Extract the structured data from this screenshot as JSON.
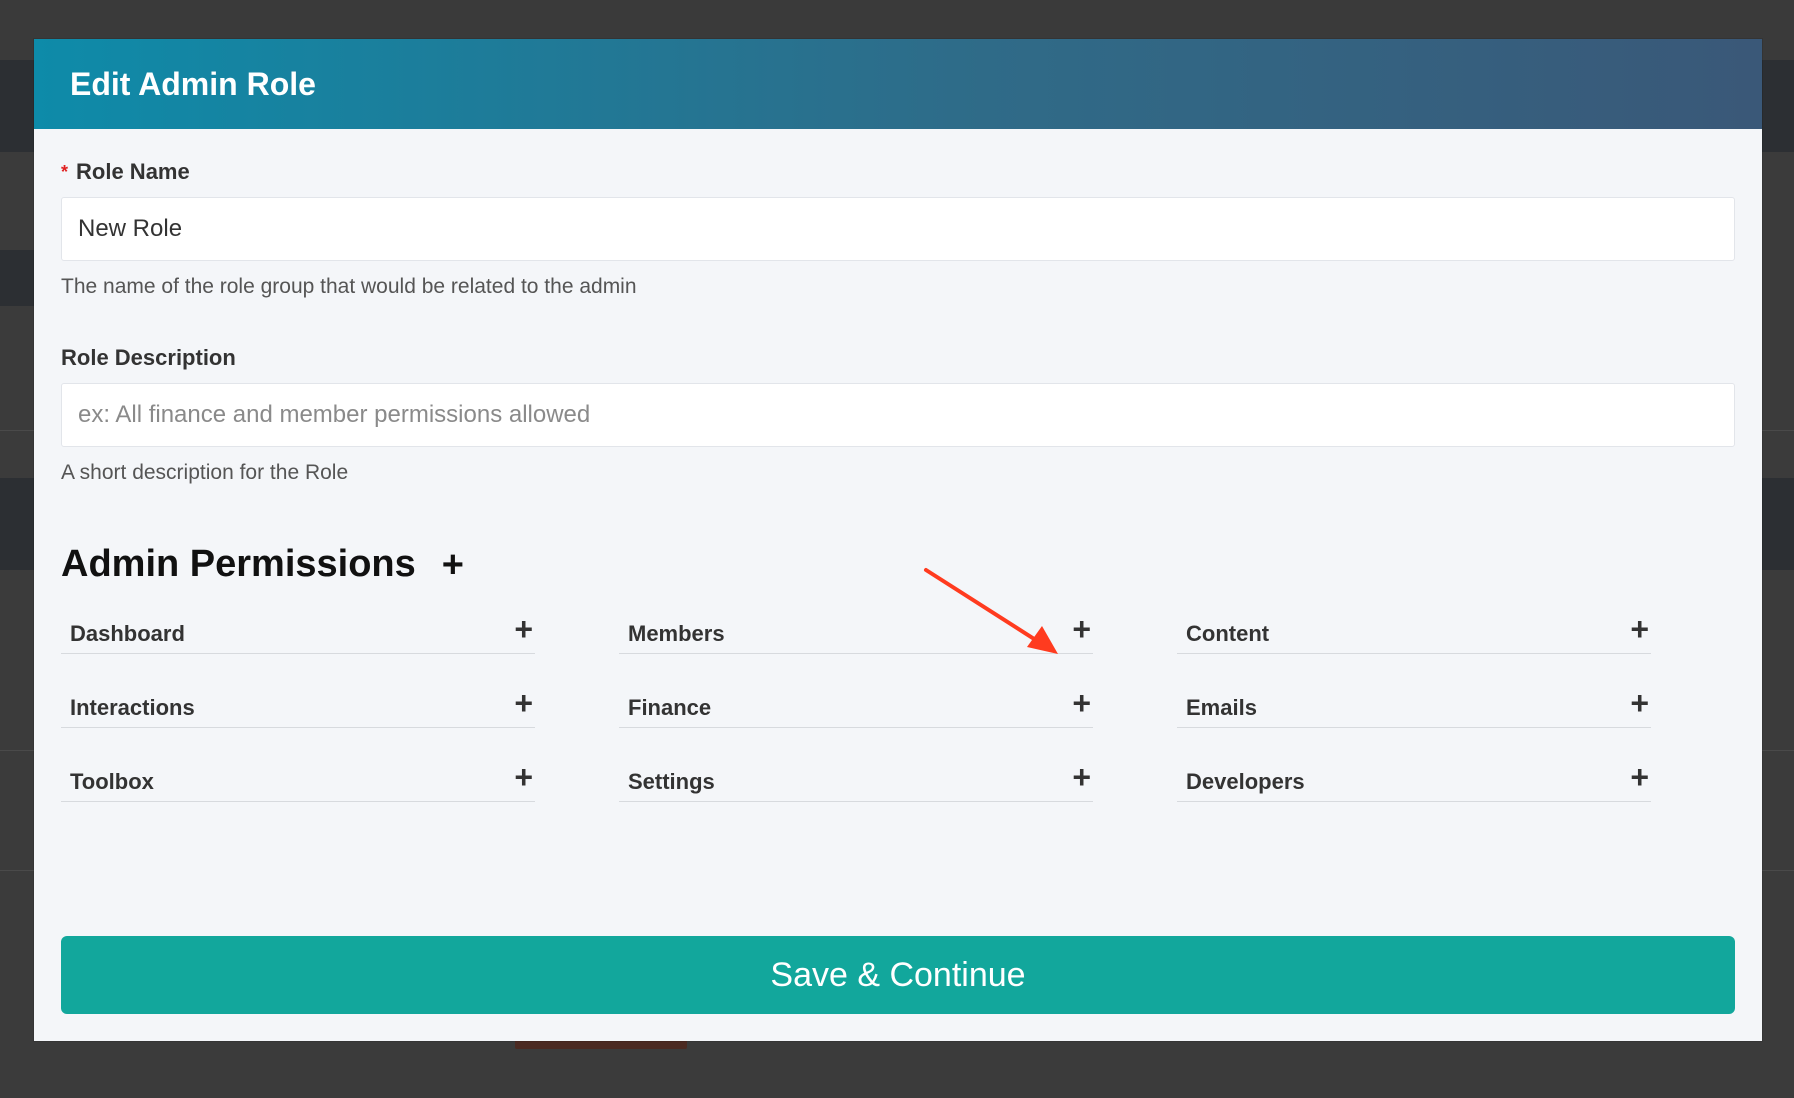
{
  "modal": {
    "title": "Edit Admin Role"
  },
  "role_name": {
    "label": "Role Name",
    "required_marker": "*",
    "value": "New Role",
    "help": "The name of the role group that would be related to the admin"
  },
  "role_description": {
    "label": "Role Description",
    "value": "",
    "placeholder": "ex: All finance and member permissions allowed",
    "help": "A short description for the Role"
  },
  "permissions": {
    "heading": "Admin Permissions",
    "add_symbol": "+",
    "items": [
      {
        "label": "Dashboard",
        "symbol": "+"
      },
      {
        "label": "Members",
        "symbol": "+"
      },
      {
        "label": "Content",
        "symbol": "+"
      },
      {
        "label": "Interactions",
        "symbol": "+"
      },
      {
        "label": "Finance",
        "symbol": "+"
      },
      {
        "label": "Emails",
        "symbol": "+"
      },
      {
        "label": "Toolbox",
        "symbol": "+"
      },
      {
        "label": "Settings",
        "symbol": "+"
      },
      {
        "label": "Developers",
        "symbol": "+"
      }
    ]
  },
  "footer": {
    "save_label": "Save & Continue"
  },
  "annotation": {
    "arrow_color": "#ff3b1f",
    "points_to": "Members"
  },
  "colors": {
    "accent": "#12a79c",
    "header_start": "#0e8ba9",
    "header_end": "#3a5878",
    "required": "#e02020"
  }
}
